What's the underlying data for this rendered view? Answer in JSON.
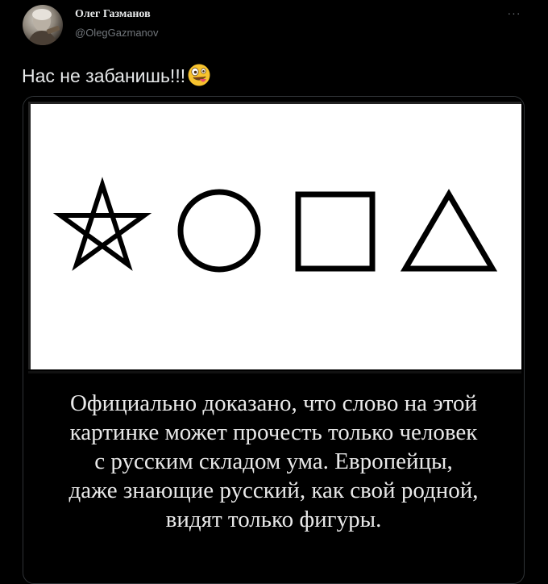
{
  "author": {
    "name": "Олег Газманов",
    "handle": "@OlegGazmanov"
  },
  "more_label": "···",
  "tweet": {
    "text": "Нас не забанишь!!!",
    "emoji": "zany-face-emoji"
  },
  "media": {
    "shapes": [
      "pentagram-icon",
      "circle-icon",
      "square-icon",
      "triangle-icon"
    ],
    "caption_lines": [
      "Официально доказано, что слово на этой",
      "картинке может прочесть только человек",
      "с русским складом ума. Европейцы,",
      "даже знающие русский, как свой родной,",
      "видят только фигуры."
    ]
  },
  "colors": {
    "background": "#000000",
    "text": "#e7e9ea",
    "secondary_text": "#71767b",
    "emoji_yellow": "#f7c32e"
  }
}
